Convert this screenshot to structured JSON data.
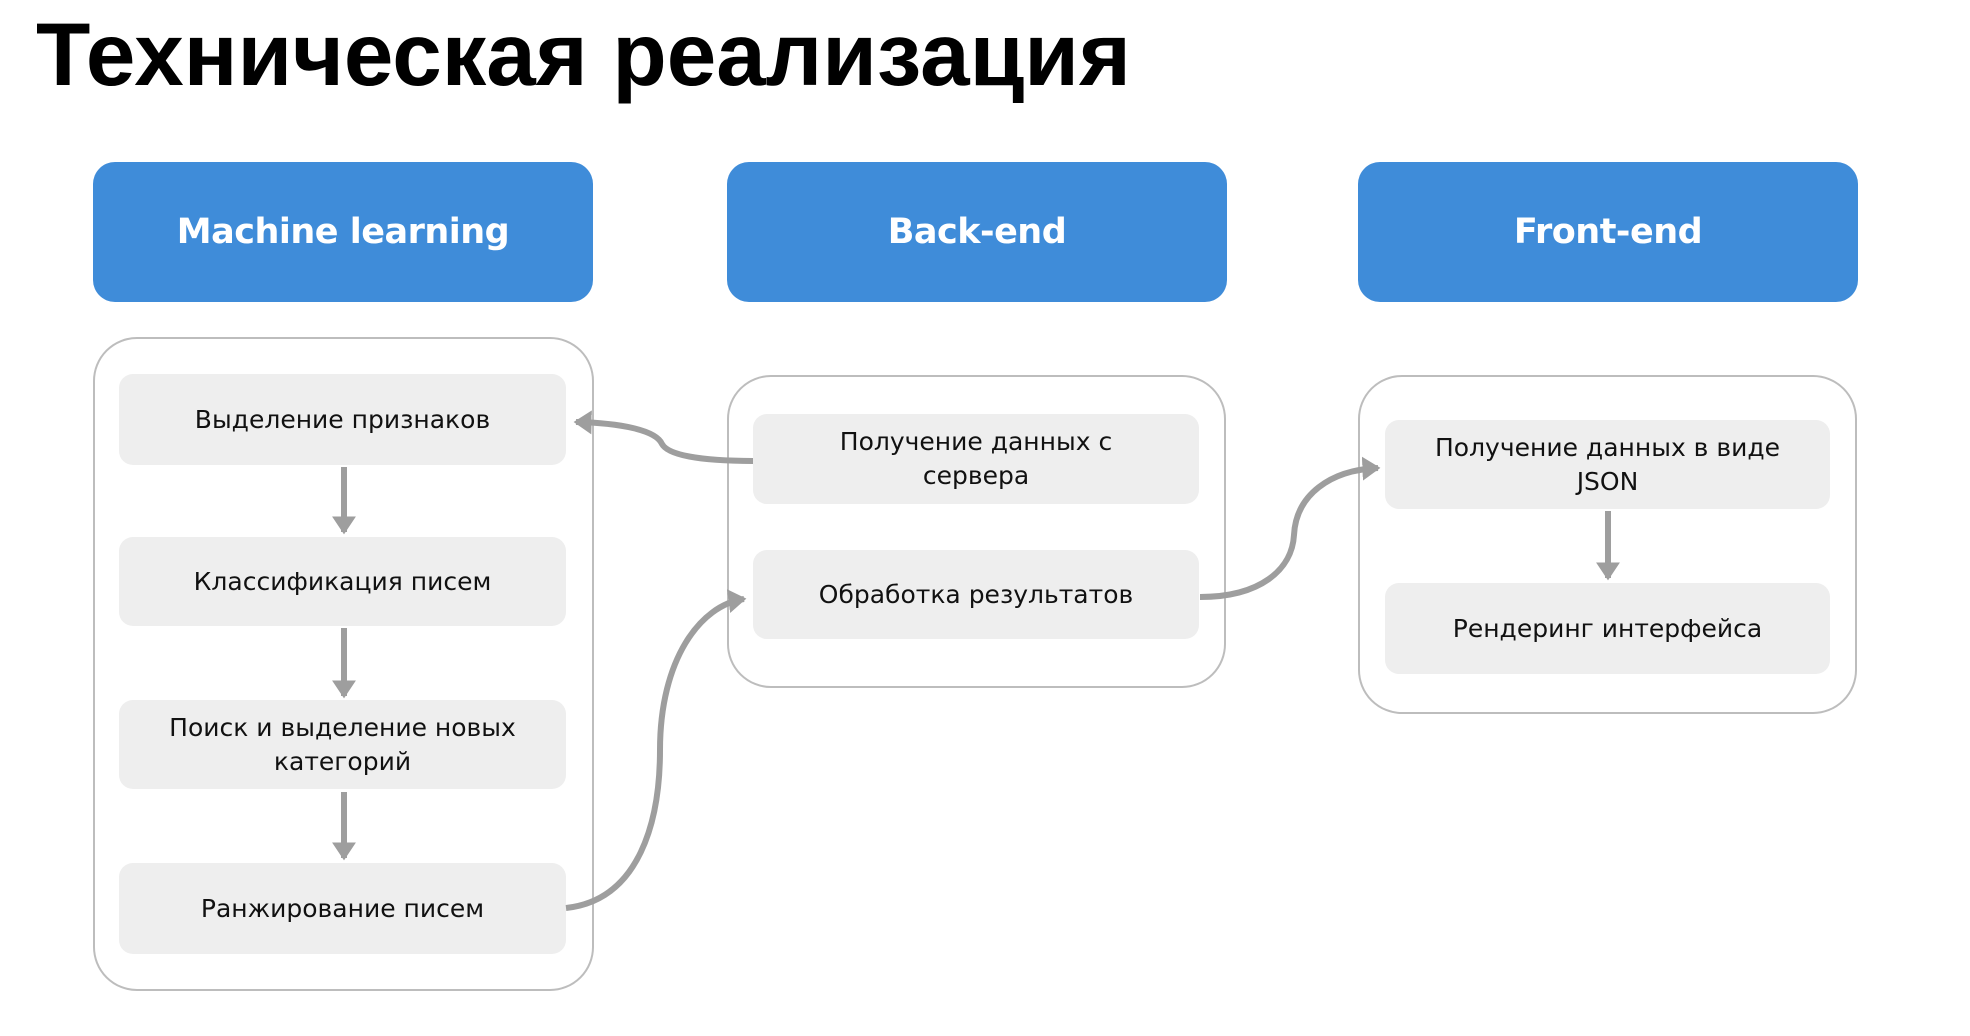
{
  "title": "Техническая реализация",
  "accent_color": "#3F8CD9",
  "step_bg_color": "#EEEEEE",
  "arrow_color": "#9E9E9E",
  "columns": [
    {
      "id": "ml",
      "header": "Machine learning",
      "steps": [
        "Выделение признаков",
        "Классификация писем",
        "Поиск и выделение новых категорий",
        "Ранжирование писем"
      ]
    },
    {
      "id": "backend",
      "header": "Back-end",
      "steps": [
        "Получение данных с сервера",
        "Обработка результатов"
      ]
    },
    {
      "id": "frontend",
      "header": "Front-end",
      "steps": [
        "Получение данных в виде JSON",
        "Рендеринг интерфейса"
      ]
    }
  ],
  "connections": [
    {
      "from": "ml.0",
      "to": "ml.1",
      "type": "vertical"
    },
    {
      "from": "ml.1",
      "to": "ml.2",
      "type": "vertical"
    },
    {
      "from": "ml.2",
      "to": "ml.3",
      "type": "vertical"
    },
    {
      "from": "backend.0",
      "to": "ml.0",
      "type": "curved"
    },
    {
      "from": "ml.3",
      "to": "backend.1",
      "type": "curved"
    },
    {
      "from": "backend.1",
      "to": "frontend.0",
      "type": "curved"
    },
    {
      "from": "frontend.0",
      "to": "frontend.1",
      "type": "vertical"
    }
  ]
}
